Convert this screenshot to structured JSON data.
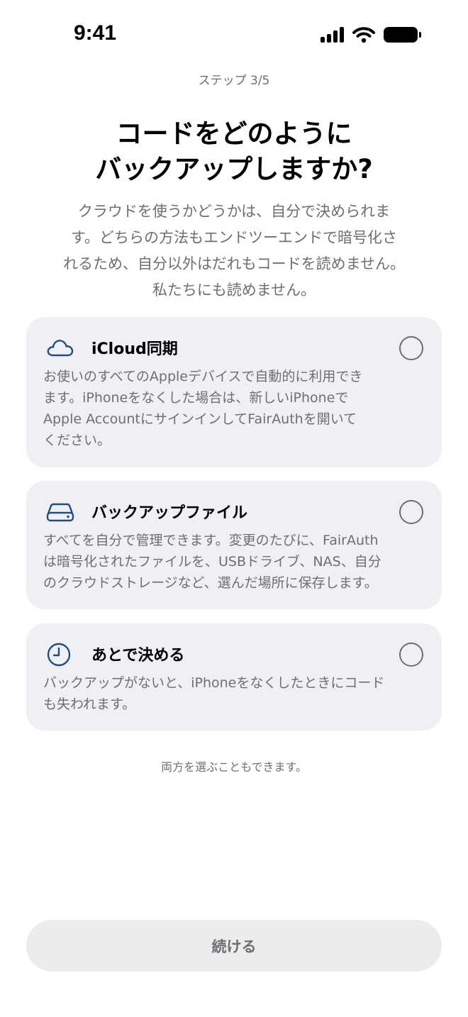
{
  "status_bar": {
    "time": "9:41"
  },
  "header": {
    "step": "ステップ 3/5",
    "title": "コードをどのように\nバックアップしますか?",
    "intro": "クラウドを使うかどうかは、自分で決められま\nす。どちらの方法もエンドツーエンドで暗号化さ\nれるため、自分以外はだれもコードを読めません。\n私たちにも読めません。"
  },
  "options": [
    {
      "title": "iCloud同期",
      "description": "お使いのすべてのAppleデバイスで自動的に利用でき\nます。iPhoneをなくした場合は、新しいiPhoneで\nApple AccountにサインインしてFairAuthを開いて\nください。",
      "icon": "cloud-icon",
      "selected": false
    },
    {
      "title": "バックアップファイル",
      "description": "すべてを自分で管理できます。変更のたびに、FairAuth\nは暗号化されたファイルを、USBドライブ、NAS、自分\nのクラウドストレージなど、選んだ場所に保存します。",
      "icon": "drive-icon",
      "selected": false
    },
    {
      "title": "あとで決める",
      "description": "バックアップがないと、iPhoneをなくしたときにコード\nも失われます。",
      "icon": "clock-icon",
      "selected": false
    }
  ],
  "footnote": "両方を選ぶこともできます。",
  "continue_label": "続ける",
  "colors": {
    "accent_icon": "#1f4e86",
    "card_background": "#f0f0f4",
    "secondary_text": "#6e6e73",
    "button_background": "#ececec"
  }
}
